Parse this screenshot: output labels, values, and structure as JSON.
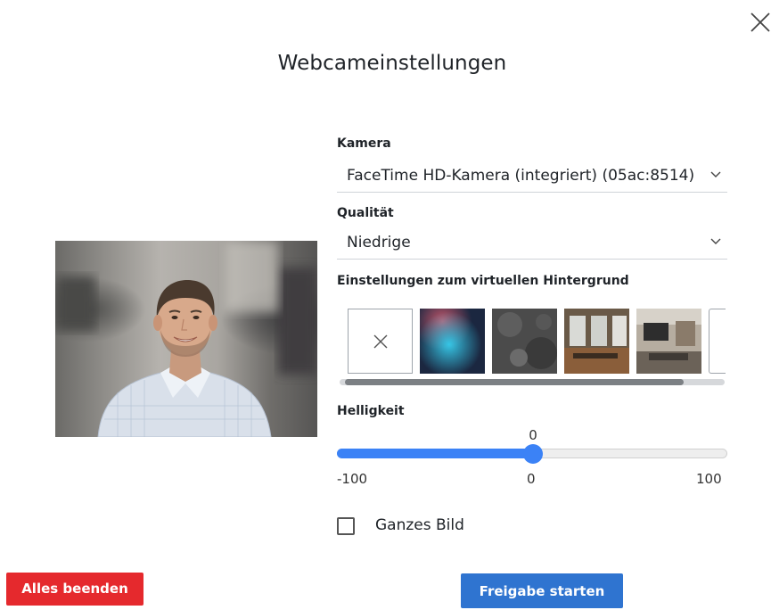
{
  "dialog": {
    "title": "Webcameinstellungen",
    "close_icon": "close-icon"
  },
  "camera": {
    "label": "Kamera",
    "selected": "FaceTime HD-Kamera (integriert) (05ac:8514)"
  },
  "quality": {
    "label": "Qualität",
    "selected": "Niedrige"
  },
  "background": {
    "label": "Einstellungen zum virtuellen Hintergrund",
    "tiles": [
      {
        "name": "none",
        "icon": "close-icon"
      },
      {
        "name": "blurred-bokeh",
        "colors": [
          "#1c2a44",
          "#2fb7d6",
          "#b24f5b"
        ]
      },
      {
        "name": "dark-texture",
        "colors": [
          "#3a3a3a",
          "#6a6a6a"
        ]
      },
      {
        "name": "office-room-1",
        "colors": [
          "#5a4c3c",
          "#c9c7c2",
          "#8a5a34"
        ]
      },
      {
        "name": "office-room-2",
        "colors": [
          "#4b4b4b",
          "#b8b0a4",
          "#3c3c3c"
        ]
      },
      {
        "name": "more"
      }
    ],
    "scroll_position": 0.88
  },
  "brightness": {
    "label": "Helligkeit",
    "value": "0",
    "min": -100,
    "max": 100,
    "value_number": 0,
    "min_label": "-100",
    "mid_label": "0",
    "max_label": "100",
    "accent": "#3b82f6"
  },
  "full_image": {
    "label": "Ganzes Bild",
    "checked": false
  },
  "buttons": {
    "end_all": "Alles beenden",
    "start_share": "Freigabe starten",
    "end_color": "#e5292d",
    "start_color": "#2f74d0"
  }
}
